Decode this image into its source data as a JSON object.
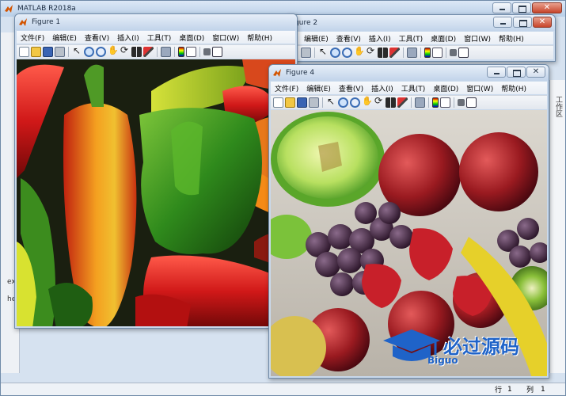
{
  "matlab": {
    "title": "MATLAB R2018a",
    "status": {
      "row_label": "行",
      "row_value": "1",
      "col_label": "列",
      "col_value": "1"
    },
    "side_labels": {
      "ex": "ex",
      "he": "he"
    },
    "right_panel_text": "工作区"
  },
  "figure2": {
    "title": "Figure 2",
    "menu": [
      "编辑(E)",
      "查看(V)",
      "插入(I)",
      "工具(T)",
      "桌面(D)",
      "窗口(W)",
      "帮助(H)"
    ]
  },
  "figure1": {
    "title": "Figure 1",
    "menu": [
      "文件(F)",
      "编辑(E)",
      "查看(V)",
      "插入(I)",
      "工具(T)",
      "桌面(D)",
      "窗口(W)",
      "帮助(H)"
    ]
  },
  "figure4": {
    "title": "Figure 4",
    "menu": [
      "文件(F)",
      "编辑(E)",
      "查看(V)",
      "插入(I)",
      "工具(T)",
      "桌面(D)",
      "窗口(W)",
      "帮助(H)"
    ]
  },
  "toolbar_icons": [
    "new-figure-icon",
    "open-file-icon",
    "save-icon",
    "print-icon",
    "edit-plot-icon",
    "zoom-in-icon",
    "zoom-out-icon",
    "pan-icon",
    "rotate-3d-icon",
    "data-cursor-icon",
    "brush-icon",
    "link-plot-icon",
    "colorbar-icon",
    "legend-icon",
    "hide-plot-tools-icon",
    "show-plot-tools-icon"
  ],
  "images": {
    "figure1": "peppers photo",
    "figure4": "fruit photo"
  },
  "watermark": {
    "brand": "必过源码",
    "domain": "Biguo"
  },
  "colors": {
    "accent": "#3b6db5",
    "watermark_blue": "#1f63c8"
  }
}
